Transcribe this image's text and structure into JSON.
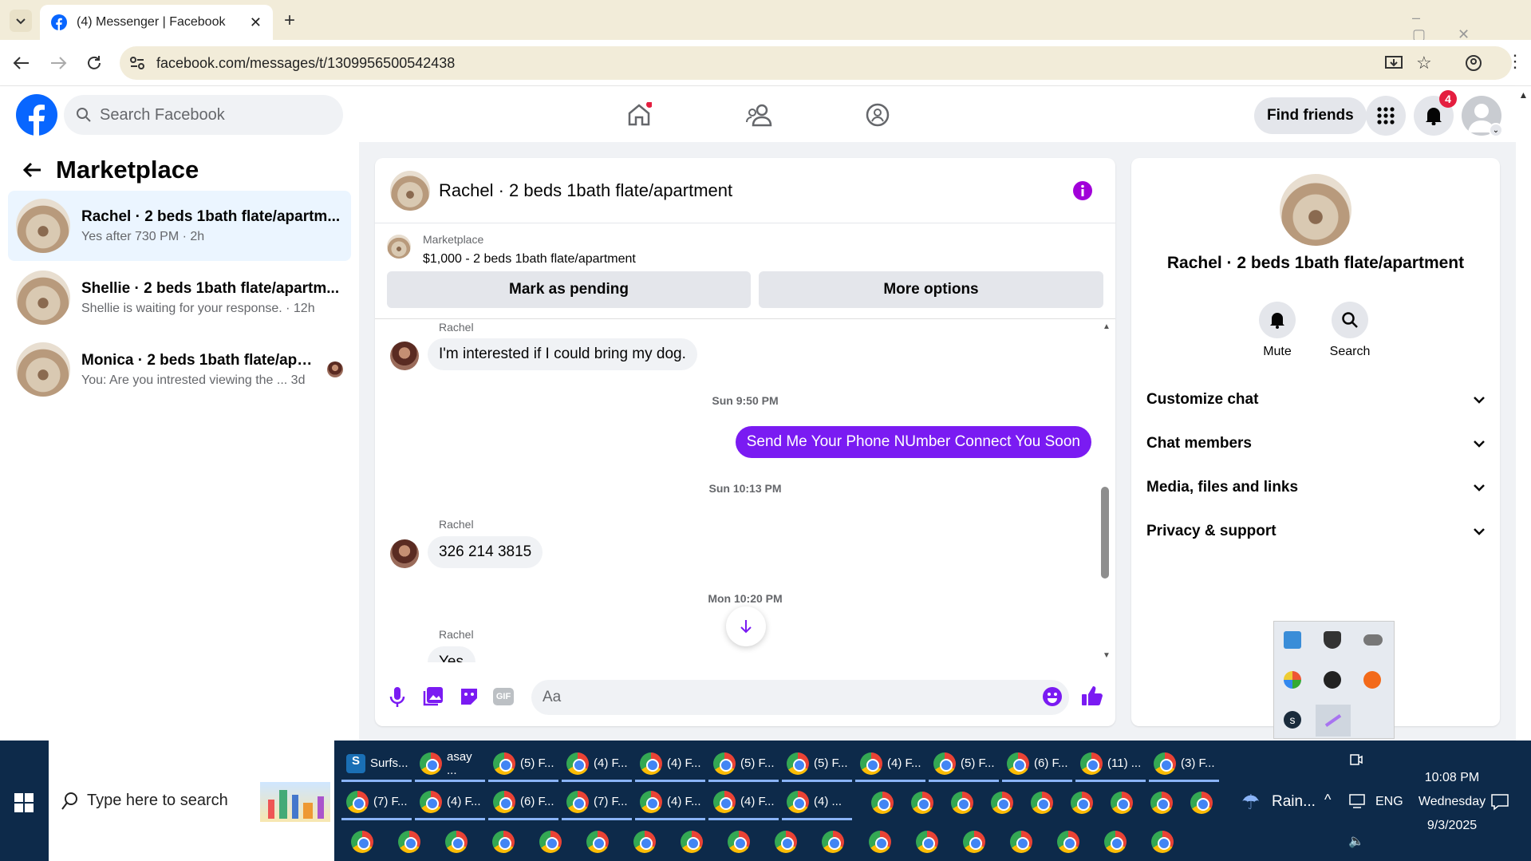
{
  "browser": {
    "tab_title": "(4) Messenger | Facebook",
    "url": "facebook.com/messages/t/1309956500542438"
  },
  "header": {
    "search_placeholder": "Search Facebook",
    "find_friends": "Find friends",
    "notification_count": "4"
  },
  "sidebar": {
    "title": "Marketplace",
    "conversations": [
      {
        "name": "Rachel · 2 beds 1bath flate/apartm...",
        "preview": "Yes after 730 PM · 2h"
      },
      {
        "name": "Shellie · 2 beds 1bath flate/apartm...",
        "preview": "Shellie is waiting for your response. · 12h"
      },
      {
        "name": "Monica · 2 beds 1bath flate/apar...",
        "preview": "You: Are you intrested viewing the ...   3d"
      }
    ]
  },
  "chat": {
    "title": "Rachel · 2 beds 1bath flate/apartment",
    "listing_label": "Marketplace",
    "listing_detail": "$1,000 - 2 beds 1bath flate/apartment",
    "mark_pending": "Mark as pending",
    "more_options": "More options",
    "messages": [
      {
        "sender": "Rachel",
        "text": "I'm interested if I could bring my dog."
      },
      {
        "timestamp": "Sun 9:50 PM"
      },
      {
        "text": "Send Me Your Phone NUmber  Connect You Soon"
      },
      {
        "timestamp": "Sun 10:13 PM"
      },
      {
        "sender": "Rachel",
        "text": "326 214 3815"
      },
      {
        "timestamp": "Mon 10:20 PM"
      },
      {
        "sender": "Rachel",
        "text": "Yes"
      }
    ],
    "composer_placeholder": "Aa"
  },
  "info": {
    "name": "Rachel · 2 beds 1bath flate/apartment",
    "mute": "Mute",
    "search": "Search",
    "sections": [
      "Customize chat",
      "Chat members",
      "Media, files and links",
      "Privacy & support"
    ]
  },
  "taskbar": {
    "search_placeholder": "Type here to search",
    "row1": [
      "Surfs...",
      "asay ...",
      "(5) F...",
      "(4) F...",
      "(4) F...",
      "(5) F...",
      "(5) F...",
      "(4) F...",
      "(5) F...",
      "(6) F...",
      "(11) ...",
      "(3) F..."
    ],
    "row2": [
      "(7) F...",
      "(4) F...",
      "(6) F...",
      "(7) F...",
      "(4) F...",
      "(4) F...",
      "(4) ..."
    ],
    "weather": "Rain...",
    "lang": "ENG",
    "time": "10:08 PM",
    "day": "Wednesday",
    "date": "9/3/2025"
  },
  "colors": {
    "fb_blue": "#0866ff",
    "accent": "#7a1bf2"
  }
}
